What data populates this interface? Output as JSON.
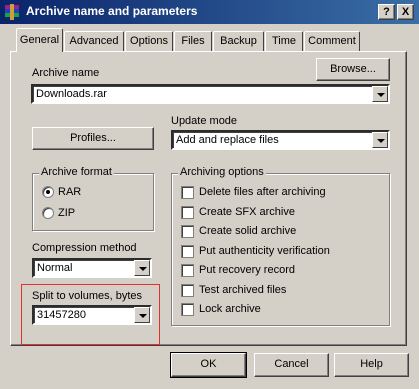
{
  "window": {
    "title": "Archive name and parameters",
    "help_btn": "?",
    "close_btn": "X"
  },
  "tabs": [
    "General",
    "Advanced",
    "Options",
    "Files",
    "Backup",
    "Time",
    "Comment"
  ],
  "archive_name": {
    "label": "Archive name",
    "value": "Downloads.rar",
    "browse": "Browse..."
  },
  "profiles": {
    "label": "Profiles..."
  },
  "update_mode": {
    "label": "Update mode",
    "value": "Add and replace files"
  },
  "archive_format": {
    "label": "Archive format",
    "options": [
      "RAR",
      "ZIP"
    ],
    "selected": "RAR"
  },
  "compression": {
    "label": "Compression method",
    "value": "Normal"
  },
  "split": {
    "label": "Split to volumes, bytes",
    "value": "31457280"
  },
  "archiving_options": {
    "label": "Archiving options",
    "items": [
      "Delete files after archiving",
      "Create SFX archive",
      "Create solid archive",
      "Put authenticity verification",
      "Put recovery record",
      "Test archived files",
      "Lock archive"
    ]
  },
  "buttons": {
    "ok": "OK",
    "cancel": "Cancel",
    "help": "Help"
  },
  "colors": {
    "title_start": "#0a246a",
    "title_end": "#3a6ea5",
    "face": "#d4d0c8",
    "highlight_box": "#e03030"
  }
}
